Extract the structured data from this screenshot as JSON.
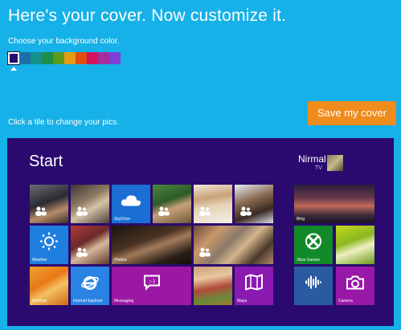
{
  "header": {
    "title": "Here's your cover. Now customize it."
  },
  "colors": {
    "label": "Choose your background color.",
    "swatches": [
      "#2a0a6e",
      "#1e6fa8",
      "#138f8c",
      "#1d8d4a",
      "#5d9a1a",
      "#e79a14",
      "#e24c13",
      "#d3135c",
      "#a72d9e",
      "#7d3fd8"
    ],
    "selected_index": 0
  },
  "instructions": {
    "change_pics": "Click a tile to change your pics."
  },
  "actions": {
    "save_label": "Save my cover"
  },
  "start": {
    "title": "Start",
    "user_name": "Nirmal",
    "user_sub": "TV",
    "tiles": [
      {
        "label": ""
      },
      {
        "label": ""
      },
      {
        "label": "SkyDrive"
      },
      {
        "label": ""
      },
      {
        "label": ""
      },
      {
        "label": ""
      },
      {
        "label": "Bing"
      },
      {
        "label": "Weather"
      },
      {
        "label": ""
      },
      {
        "label": "Photos"
      },
      {
        "label": ""
      },
      {
        "label": "Xbox Games"
      },
      {
        "label": ""
      },
      {
        "label": "Desktop"
      },
      {
        "label": "Internet Explorer"
      },
      {
        "label": "Messaging"
      },
      {
        "label": ""
      },
      {
        "label": "Maps"
      },
      {
        "label": ""
      },
      {
        "label": "Camera"
      }
    ]
  }
}
